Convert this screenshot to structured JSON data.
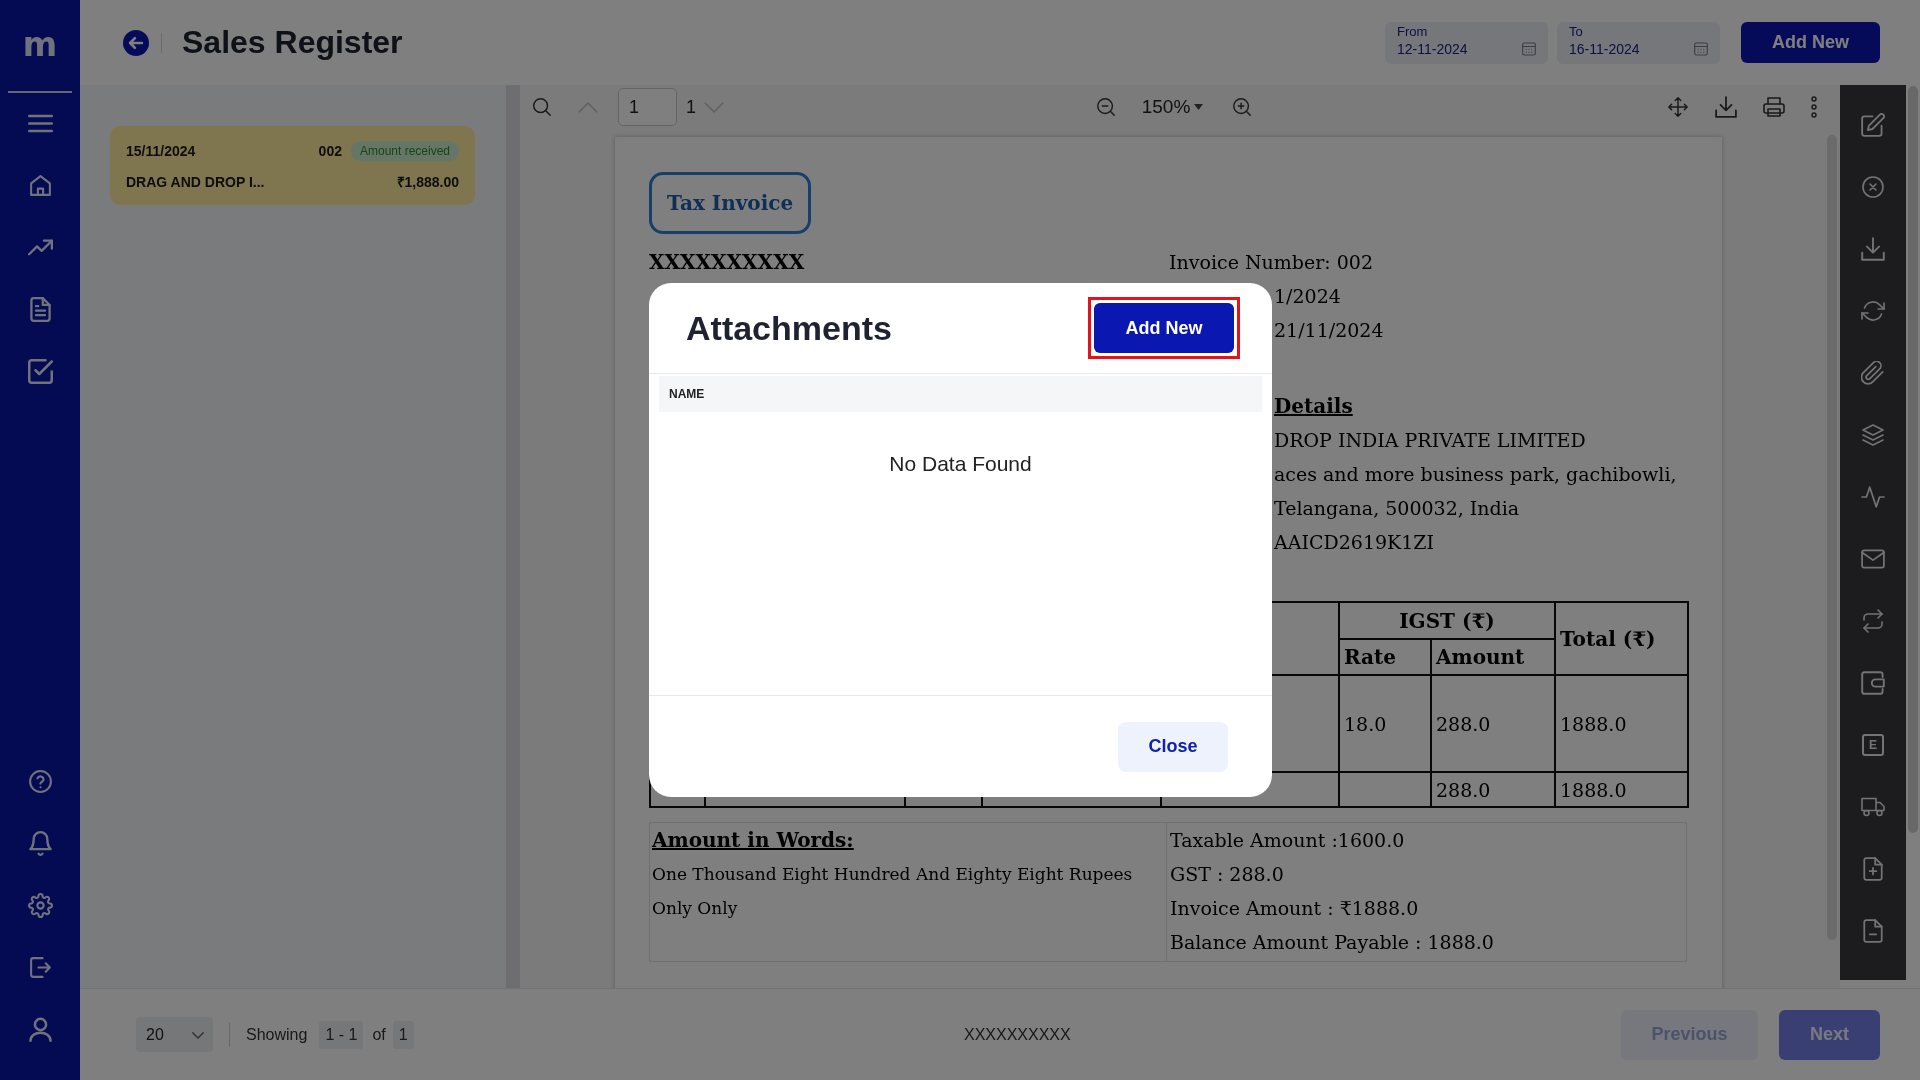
{
  "sidebar": {
    "logo": "m"
  },
  "header": {
    "title": "Sales Register",
    "date_fields": [
      {
        "label": "From",
        "value": "12-11-2024"
      },
      {
        "label": "To",
        "value": "16-11-2024"
      }
    ],
    "add_button": "Add New"
  },
  "invoice_list": [
    {
      "date": "15/11/2024",
      "number": "002",
      "status": "Amount received",
      "customer": "DRAG AND DROP I...",
      "amount": "₹1,888.00",
      "selected": true
    }
  ],
  "viewer": {
    "page_buttons": [
      {
        "kind": "up",
        "disabled": true
      },
      {
        "kind": "down",
        "disabled": true
      }
    ],
    "page_input": "1",
    "page_count": "1",
    "zoom": "150%"
  },
  "document": {
    "title": "Tax Invoice",
    "seller": "XXXXXXXXXX",
    "invoice_lines": [
      "Invoice Number: 002",
      "1/2024",
      "21/11/2024"
    ],
    "customer_heading": "Details",
    "customer_lines": [
      "DROP INDIA PRIVATE LIMITED",
      "aces and more business park, gachibowli,",
      "Telangana, 500032, India",
      "AAICD2619K1ZI"
    ],
    "table": {
      "group_header": "IGST (₹)",
      "sub_headers": [
        "Rate",
        "Amount"
      ],
      "total_header": "Total (₹)",
      "rows": [
        {
          "kind": "item",
          "rate": "18.0",
          "amount": "288.0",
          "total": "1888.0"
        },
        {
          "kind": "total",
          "amount": "288.0",
          "total": "1888.0"
        }
      ]
    },
    "amount_in_words": {
      "heading": "Amount in Words:",
      "text": "One Thousand Eight Hundred And Eighty Eight Rupees Only Only"
    },
    "summary": [
      "Taxable Amount :1600.0",
      "GST : 288.0",
      "Invoice Amount : ₹1888.0",
      "Balance Amount Payable : 1888.0"
    ]
  },
  "right_toolbar": {
    "letter_icon": "E"
  },
  "footer": {
    "page_size": "20",
    "showing": "Showing",
    "range": "1 - 1",
    "of": "of",
    "total": "1",
    "center_text": "XXXXXXXXXX",
    "buttons": [
      {
        "label": "Previous",
        "kind": "secondary",
        "disabled": true
      },
      {
        "label": "Next",
        "kind": "primary",
        "disabled": true
      }
    ]
  },
  "modal": {
    "open": true,
    "title": "Attachments",
    "add_button": {
      "label": "Add New",
      "highlighted": true
    },
    "columns": [
      "NAME"
    ],
    "empty_message": "No Data Found",
    "close_button": "Close"
  }
}
